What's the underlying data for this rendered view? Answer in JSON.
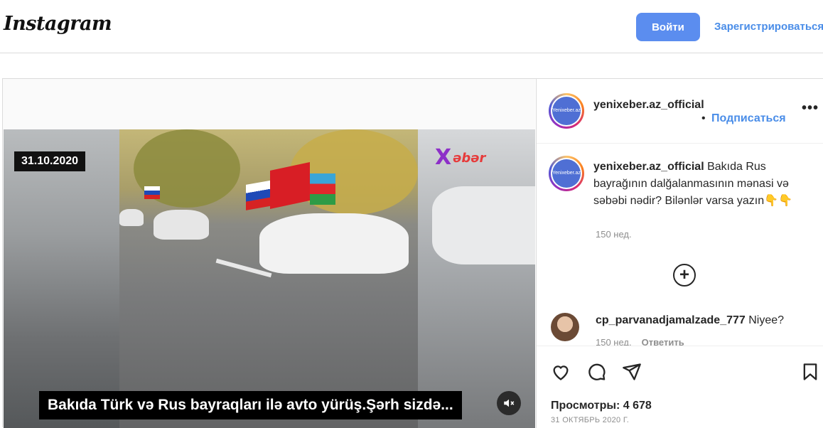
{
  "header": {
    "logo": "Instagram",
    "login_label": "Войти",
    "signup_label": "Зарегистрироваться"
  },
  "video": {
    "date_badge": "31.10.2020",
    "channel_logo_mark": "X",
    "channel_logo_name": "əbər",
    "subtitle": "Bakıda Türk və Rus bayraqları ilə avto yürüş.Şərh sizdə...",
    "mute_icon": "speaker-muted-icon"
  },
  "sidebar": {
    "author": {
      "avatar_text": "Yenixeber.az",
      "username": "yenixeber.az_official",
      "separator": "•",
      "follow_label": "Подписаться",
      "more_label": "•••"
    },
    "caption": {
      "username": "yenixeber.az_official",
      "text": " Bakıda Rus bayrağının dalğalanmasının mənasi və səbəbi nədir? Bilənlər varsa yazın👇👇",
      "time_ago": "150 нед."
    },
    "load_more_icon": "+",
    "comments": [
      {
        "username": "cp_parvanadjamalzade_777",
        "text": " Niyee?",
        "time_ago": "150 нед.",
        "reply_label": "Ответить"
      }
    ],
    "actions": [
      "heart-icon",
      "comment-icon",
      "share-icon",
      "bookmark-icon"
    ],
    "views": "Просмотры: 4 678",
    "date": "31 ОКТЯБРЬ 2020 Г."
  }
}
